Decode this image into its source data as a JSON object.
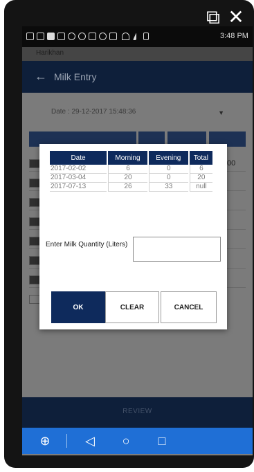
{
  "window_controls": {
    "external_glyph": "⧉",
    "close_glyph": "✕"
  },
  "status_bar": {
    "time": "3:48 PM",
    "operator": "Harikhan"
  },
  "app_bar": {
    "back_glyph": "←",
    "title": "Milk Entry"
  },
  "background": {
    "date_label": "Date : 29-12-2017 15:48:36",
    "dropdown_glyph": "▼",
    "peek_value": "00",
    "review_label": "REVIEW"
  },
  "dialog": {
    "table": {
      "headers": [
        "Date",
        "Morning",
        "Evening",
        "Total"
      ],
      "rows": [
        [
          "2017-02-02",
          "6",
          "0",
          "6"
        ],
        [
          "2017-03-04",
          "20",
          "0",
          "20"
        ],
        [
          "2017-07-13",
          "26",
          "33",
          "null"
        ]
      ]
    },
    "quantity_label": "Enter Milk Quantity (Liters)",
    "quantity_value": "",
    "ok_label": "OK",
    "clear_label": "CLEAR",
    "cancel_label": "CANCEL"
  },
  "nav_bar": {
    "app_glyph": "⊕",
    "back_glyph": "◁",
    "home_glyph": "○",
    "recents_glyph": "□"
  },
  "colors": {
    "app_bar": "#0e1f3a",
    "dialog_header": "#0e2a5c",
    "nav_bar": "#1f6fd6"
  }
}
